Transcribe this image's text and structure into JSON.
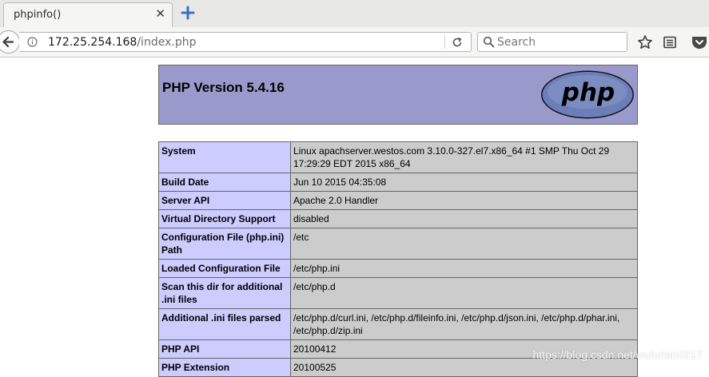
{
  "browser": {
    "tab_title": "phpinfo()",
    "url_host": "172.25.254.168",
    "url_path": "/index.php",
    "search_placeholder": "Search"
  },
  "phpinfo": {
    "version_title": "PHP Version 5.4.16",
    "logo_text": "php",
    "logo_color": "#6c7eb7",
    "header_color": "#9999cc",
    "rows": [
      {
        "key": "System",
        "value": "Linux apachserver.westos.com 3.10.0-327.el7.x86_64 #1 SMP Thu Oct 29 17:29:29 EDT 2015 x86_64"
      },
      {
        "key": "Build Date",
        "value": "Jun 10 2015 04:35:08"
      },
      {
        "key": "Server API",
        "value": "Apache 2.0 Handler"
      },
      {
        "key": "Virtual Directory Support",
        "value": "disabled"
      },
      {
        "key": "Configuration File (php.ini) Path",
        "value": "/etc"
      },
      {
        "key": "Loaded Configuration File",
        "value": "/etc/php.ini"
      },
      {
        "key": "Scan this dir for additional .ini files",
        "value": "/etc/php.d"
      },
      {
        "key": "Additional .ini files parsed",
        "value": "/etc/php.d/curl.ini, /etc/php.d/fileinfo.ini, /etc/php.d/json.ini, /etc/php.d/phar.ini, /etc/php.d/zip.ini"
      },
      {
        "key": "PHP API",
        "value": "20100412"
      },
      {
        "key": "PHP Extension",
        "value": "20100525"
      }
    ]
  },
  "watermark": "https://blog.csdn.net/wuludan0217"
}
